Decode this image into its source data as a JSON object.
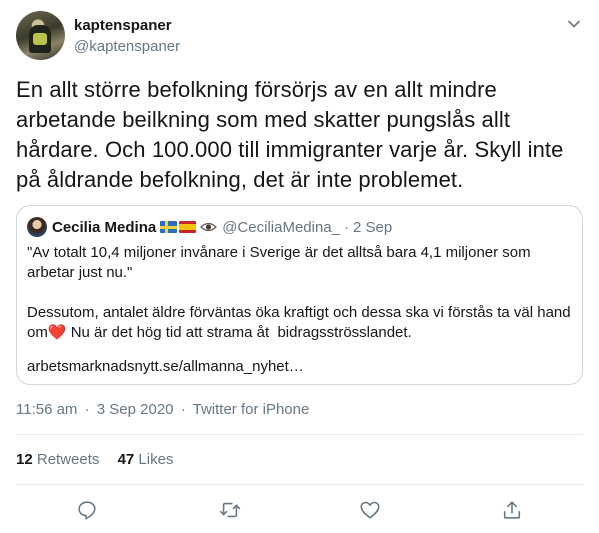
{
  "author": {
    "display_name": "kaptenspaner",
    "handle": "@kaptenspaner"
  },
  "tweet": {
    "text": "En allt större befolkning försörjs av en allt mindre arbetande beilkning som med skatter pungslås allt hårdare. Och 100.000 till immigranter varje år. Skyll inte på åldrande befolkning, det är inte problemet.",
    "time": "11:56 am",
    "separator": "·",
    "date": "3 Sep 2020",
    "source": "Twitter for iPhone"
  },
  "quoted_tweet": {
    "display_name": "Cecilia Medina",
    "handle": "@CeciliaMedina_",
    "separator": "·",
    "date": "2 Sep",
    "body_part1": "\"Av totalt 10,4 miljoner invånare i Sverige är det alltså bara 4,1 miljoner som arbetar just nu.\"\n\nDessutom, antalet äldre förväntas öka kraftigt och dessa ska vi förstås ta väl hand om",
    "heart": "❤️",
    "body_part2": " Nu är det hög tid att strama åt  bidragsströsslandet.",
    "link": "arbetsmarknadsnytt.se/allmanna_nyhet…"
  },
  "stats": {
    "retweets_count": "12",
    "retweets_label": "Retweets",
    "likes_count": "47",
    "likes_label": "Likes"
  },
  "icons": {
    "caret": "chevron-down-icon",
    "reply": "reply-icon",
    "retweet": "retweet-icon",
    "like": "heart-icon",
    "share": "share-icon"
  },
  "colors": {
    "text": "#14171a",
    "secondary": "#657786",
    "border": "#ccd6dd",
    "heart": "#e0245e"
  }
}
